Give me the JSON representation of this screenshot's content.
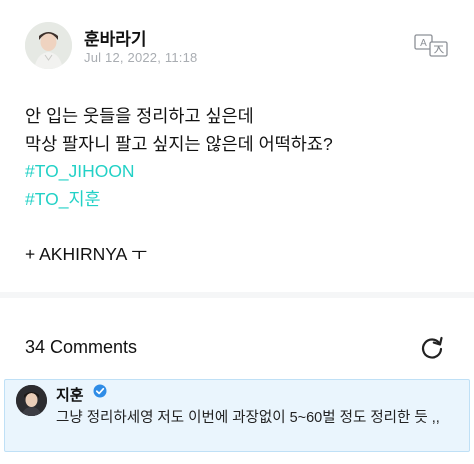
{
  "post": {
    "author": "훈바라기",
    "timestamp": "Jul 12, 2022, 11:18",
    "translate_icon": "translate-icon",
    "lines": [
      "안 입는 웃들을 정리하고 싶은데",
      "막상 팔자니 팔고 싶지는 않은데 어떡하죠?"
    ],
    "hashtags": [
      "#TO_JIHOON",
      "#TO_지훈"
    ],
    "signature": "+ AKHIRNYA ㅜ"
  },
  "comments_header": {
    "count_label": "34 Comments",
    "refresh_icon": "refresh-icon"
  },
  "comment": {
    "author": "지훈",
    "verified_icon": "verified-badge-icon",
    "text": "그냥 정리하세영 저도 이번에 과장없이 5~60벌 정도 정리한 듯 ,,"
  },
  "colors": {
    "hashtag": "#22d1c6",
    "comment_bg": "#eaf5fd",
    "comment_border": "#bfe0f6",
    "badge": "#2f8ce6",
    "timestamp": "#a9adb2"
  }
}
